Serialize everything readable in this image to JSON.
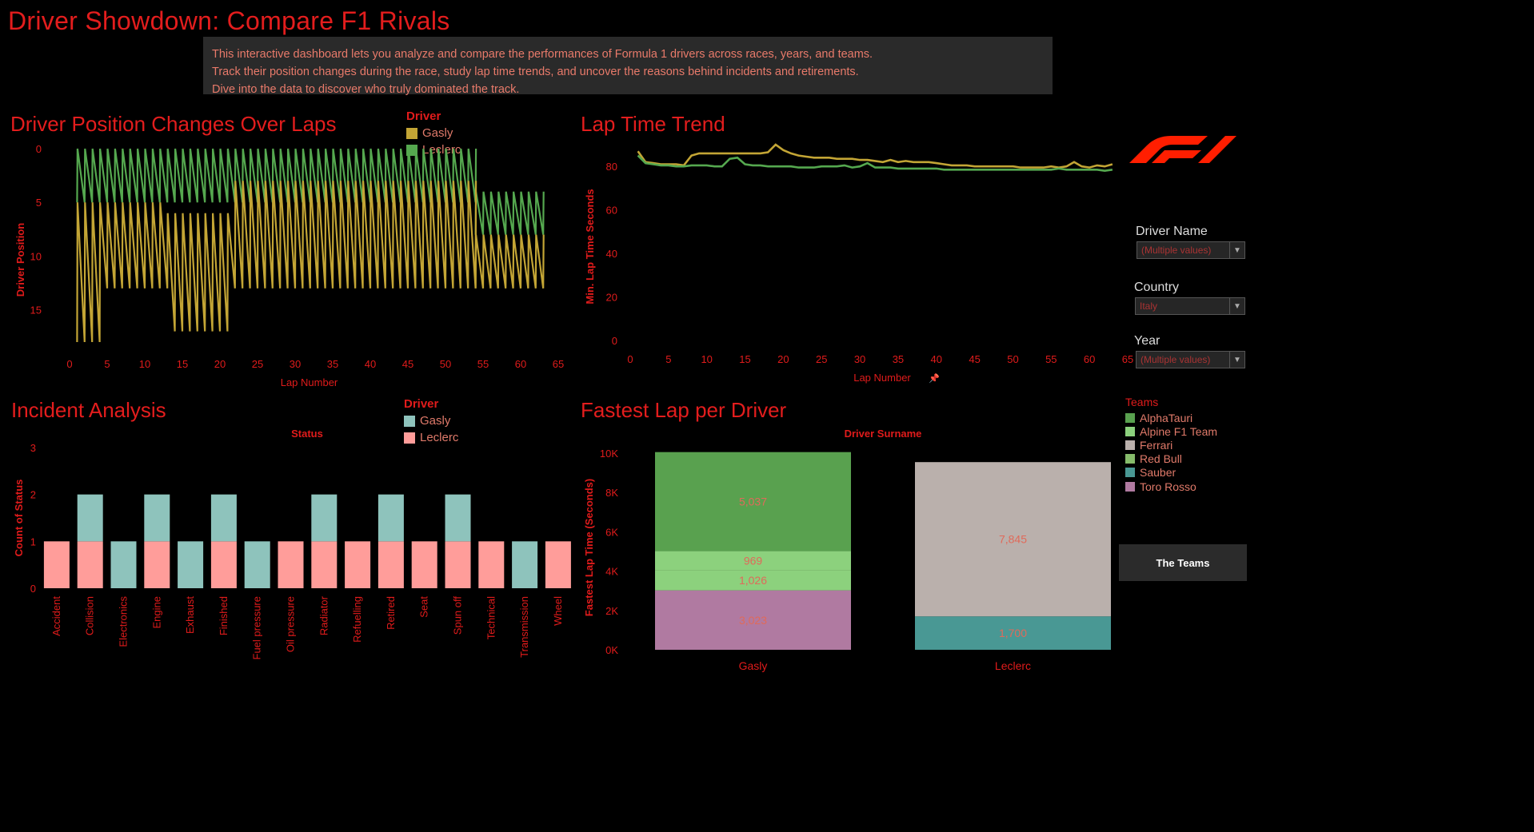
{
  "page": {
    "title": "Driver Showdown: Compare F1 Rivals",
    "description": [
      "This interactive dashboard lets you analyze and compare the performances of Formula 1 drivers across races, years, and teams.",
      "Track their position changes during the race, study lap time trends, and uncover the reasons behind incidents and retirements.",
      "Dive into the data to discover who truly dominated the track."
    ]
  },
  "colors": {
    "accent": "#e01b1b",
    "gasly_line": "#c3a535",
    "leclerc_line": "#55a84f",
    "gasly_bar": "#8ec3bc",
    "leclerc_bar": "#ff9d9a"
  },
  "filters": {
    "driver_name": {
      "label": "Driver Name",
      "value": "(Multiple values)"
    },
    "country": {
      "label": "Country",
      "value": "Italy"
    },
    "year": {
      "label": "Year",
      "value": "(Multiple values)"
    }
  },
  "teams_legend": {
    "title": "Teams",
    "items": [
      {
        "name": "AlphaTauri",
        "color": "#59a14f"
      },
      {
        "name": "Alpine F1 Team",
        "color": "#8cd17d"
      },
      {
        "name": "Ferrari",
        "color": "#bab0ac"
      },
      {
        "name": "Red Bull",
        "color": "#86bc6b"
      },
      {
        "name": "Sauber",
        "color": "#499894"
      },
      {
        "name": "Toro Rosso",
        "color": "#b07aa1"
      }
    ],
    "button_label": "The Teams"
  },
  "logo_icon": "f1-logo",
  "chart_data": [
    {
      "id": "positions",
      "type": "line",
      "title": "Driver Position Changes Over Laps",
      "xlabel": "Lap Number",
      "ylabel": "Driver Position",
      "xlim": [
        0,
        65
      ],
      "ylim": [
        0,
        18
      ],
      "y_reversed": true,
      "x_ticks": [
        0,
        5,
        10,
        15,
        20,
        25,
        30,
        35,
        40,
        45,
        50,
        55,
        60,
        65
      ],
      "y_ticks": [
        0,
        5,
        10,
        15
      ],
      "legend_title": "Driver",
      "series": [
        {
          "name": "Gasly",
          "color": "#c3a535"
        },
        {
          "name": "Leclerc",
          "color": "#55a84f"
        }
      ]
    },
    {
      "id": "laptime",
      "type": "line",
      "title": "Lap Time Trend",
      "xlabel": "Lap Number",
      "ylabel": "Min. Lap Time Seconds",
      "xlim": [
        0,
        65
      ],
      "ylim": [
        0,
        90
      ],
      "x_ticks": [
        0,
        5,
        10,
        15,
        20,
        25,
        30,
        35,
        40,
        45,
        50,
        55,
        60,
        65
      ],
      "y_ticks": [
        0,
        20,
        40,
        60,
        80
      ],
      "series": [
        {
          "name": "Gasly",
          "color": "#c3a535",
          "x": [
            1,
            2,
            3,
            4,
            5,
            6,
            7,
            8,
            9,
            10,
            11,
            12,
            13,
            14,
            15,
            16,
            17,
            18,
            19,
            20,
            21,
            22,
            23,
            24,
            25,
            26,
            27,
            28,
            29,
            30,
            31,
            32,
            33,
            34,
            35,
            36,
            37,
            38,
            39,
            40,
            41,
            42,
            43,
            44,
            45,
            46,
            47,
            48,
            49,
            50,
            51,
            52,
            53,
            54,
            55,
            56,
            57,
            58,
            59,
            60,
            61,
            62,
            63
          ],
          "y": [
            87,
            82,
            81.5,
            81,
            81,
            81,
            80.5,
            85,
            86,
            86,
            86,
            86,
            86,
            86,
            86,
            86,
            86,
            86.5,
            90,
            87.5,
            86,
            85,
            84.5,
            84,
            84,
            84,
            83.5,
            83.5,
            83.5,
            83,
            83,
            82.5,
            82,
            83,
            82,
            82.5,
            82,
            82,
            82,
            81.5,
            81,
            80.5,
            80.5,
            80.5,
            80,
            80,
            80,
            80,
            80,
            80,
            79.5,
            79.5,
            79.5,
            79.5,
            80,
            79.5,
            80,
            82,
            80,
            79.5,
            80.5,
            80,
            81
          ]
        },
        {
          "name": "Leclerc",
          "color": "#55a84f",
          "x": [
            1,
            2,
            3,
            4,
            5,
            6,
            7,
            8,
            9,
            10,
            11,
            12,
            13,
            14,
            15,
            16,
            17,
            18,
            19,
            20,
            21,
            22,
            23,
            24,
            25,
            26,
            27,
            28,
            29,
            30,
            31,
            32,
            33,
            34,
            35,
            36,
            37,
            38,
            39,
            40,
            41,
            42,
            43,
            44,
            45,
            46,
            47,
            48,
            49,
            50,
            51,
            52,
            53,
            54,
            55,
            56,
            57,
            58,
            59,
            60,
            61,
            62,
            63
          ],
          "y": [
            85,
            81.5,
            81,
            80.5,
            80.5,
            80,
            80,
            80.5,
            80.5,
            80.5,
            80,
            80,
            83.5,
            84,
            81,
            80.5,
            80.5,
            80,
            80,
            80,
            80,
            79.5,
            79.5,
            79.5,
            80,
            80,
            80,
            80.5,
            79.5,
            80,
            81.5,
            79.5,
            79.5,
            79.5,
            79,
            79,
            79,
            79,
            79,
            79,
            78.5,
            78.5,
            78.5,
            78.5,
            78.5,
            78.5,
            78.5,
            78.5,
            78.5,
            78.5,
            78.5,
            78.5,
            78.5,
            78.5,
            78.5,
            79,
            78.5,
            78.5,
            78.5,
            78.5,
            78.5,
            78,
            78.5
          ]
        }
      ]
    },
    {
      "id": "incidents",
      "type": "bar",
      "stacked": true,
      "title": "Incident Analysis",
      "header": "Status",
      "ylabel": "Count of Status",
      "ylim": [
        0,
        3
      ],
      "y_ticks": [
        0,
        1,
        2,
        3
      ],
      "legend_title": "Driver",
      "categories": [
        "Accident",
        "Collision",
        "Electronics",
        "Engine",
        "Exhaust",
        "Finished",
        "Fuel pressure",
        "Oil pressure",
        "Radiator",
        "Refuelling",
        "Retired",
        "Seat",
        "Spun off",
        "Technical",
        "Transmission",
        "Wheel"
      ],
      "series": [
        {
          "name": "Leclerc",
          "color": "#ff9d9a",
          "values": [
            1,
            1,
            0,
            1,
            0,
            1,
            0,
            1,
            1,
            1,
            1,
            1,
            1,
            1,
            0,
            1
          ]
        },
        {
          "name": "Gasly",
          "color": "#8ec3bc",
          "values": [
            0,
            1,
            1,
            1,
            1,
            1,
            1,
            0,
            1,
            0,
            1,
            0,
            1,
            0,
            1,
            0
          ]
        }
      ]
    },
    {
      "id": "fastest",
      "type": "bar",
      "stacked": true,
      "title": "Fastest Lap per Driver",
      "header": "Driver Surname",
      "ylabel": "Fastest Lap Time (Seconds)",
      "ylim": [
        0,
        10000
      ],
      "y_ticks": [
        0,
        2000,
        4000,
        6000,
        8000,
        10000
      ],
      "y_tick_labels": [
        "0K",
        "2K",
        "4K",
        "6K",
        "8K",
        "10K"
      ],
      "categories": [
        "Gasly",
        "Leclerc"
      ],
      "stacks": [
        {
          "category": "Gasly",
          "segments": [
            {
              "team": "Toro Rosso",
              "value": 3023,
              "label": "3,023",
              "color": "#b07aa1"
            },
            {
              "team": "Red Bull",
              "value": 1026,
              "label": "1,026",
              "color": "#8cd17d"
            },
            {
              "team": "Alpine F1 Team",
              "value": 969,
              "label": "969",
              "color": "#8cd17d"
            },
            {
              "team": "AlphaTauri",
              "value": 5037,
              "label": "5,037",
              "color": "#59a14f"
            }
          ]
        },
        {
          "category": "Leclerc",
          "segments": [
            {
              "team": "Sauber",
              "value": 1700,
              "label": "1,700",
              "color": "#499894"
            },
            {
              "team": "Ferrari",
              "value": 7845,
              "label": "7,845",
              "color": "#bab0ac"
            }
          ]
        }
      ]
    }
  ]
}
